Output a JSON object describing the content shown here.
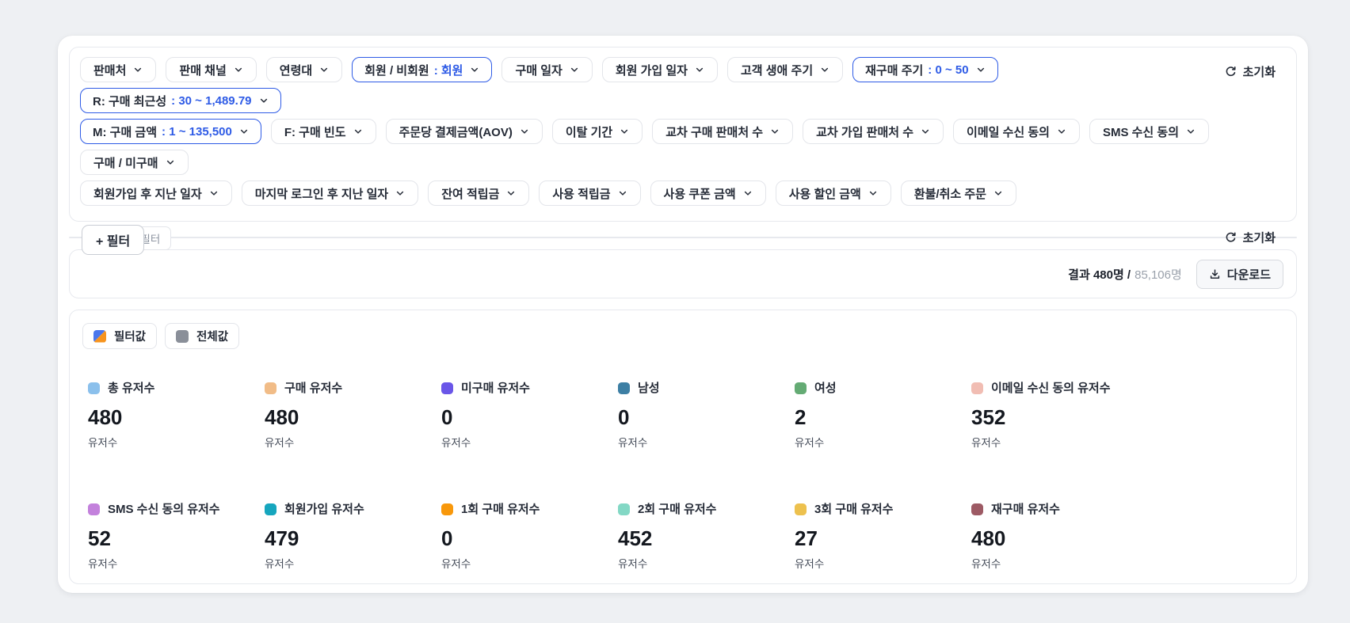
{
  "accent_color": "#2E5BE6",
  "filter_panel": {
    "reset_label": "초기화",
    "rows": [
      [
        {
          "label": "판매처"
        },
        {
          "label": "판매 채널"
        },
        {
          "label": "연령대"
        },
        {
          "label": "회원 / 비회원",
          "value": ": 회원"
        },
        {
          "label": "구매 일자"
        },
        {
          "label": "회원 가입 일자"
        },
        {
          "label": "고객 생애 주기"
        },
        {
          "label": "재구매 주기",
          "value": ": 0 ~ 50"
        },
        {
          "label": "R: 구매 최근성",
          "value": ": 30 ~ 1,489.79"
        }
      ],
      [
        {
          "label": "M: 구매 금액",
          "value": ": 1 ~ 135,500"
        },
        {
          "label": "F: 구매 빈도"
        },
        {
          "label": "주문당 결제금액(AOV)"
        },
        {
          "label": "이탈 기간"
        },
        {
          "label": "교차 구매 판매처 수"
        },
        {
          "label": "교차 가입 판매처 수"
        },
        {
          "label": "이메일 수신 동의"
        },
        {
          "label": "SMS 수신 동의"
        },
        {
          "label": "구매 / 미구매"
        }
      ],
      [
        {
          "label": "회원가입 후 지난 일자"
        },
        {
          "label": "마지막 로그인 후 지난 일자"
        },
        {
          "label": "잔여 적립금"
        },
        {
          "label": "사용 적립금"
        },
        {
          "label": "사용 쿠폰 금액"
        },
        {
          "label": "사용 할인 금액"
        },
        {
          "label": "환불/취소 주문"
        }
      ]
    ]
  },
  "segment_panel": {
    "title": "세그먼트 필터",
    "add_filter_label": "+ 필터",
    "reset_label": "초기화"
  },
  "results_bar": {
    "result_text": "결과 480명 /",
    "total_text": "85,106명",
    "download_label": "다운로드"
  },
  "metrics_panel": {
    "legend": [
      {
        "label": "필터값",
        "color_top": "#4A77ED",
        "color_bottom": "#F7941E"
      },
      {
        "label": "전체값",
        "color": "#8A8F99"
      }
    ],
    "cards": [
      {
        "label": "총 유저수",
        "value": "480",
        "sublabel": "유저수",
        "color": "#8BC0EC"
      },
      {
        "label": "구매 유저수",
        "value": "480",
        "sublabel": "유저수",
        "color": "#F1BC87"
      },
      {
        "label": "미구매 유저수",
        "value": "0",
        "sublabel": "유저수",
        "color": "#6A56E8"
      },
      {
        "label": "남성",
        "value": "0",
        "sublabel": "유저수",
        "color": "#3D7FA4"
      },
      {
        "label": "여성",
        "value": "2",
        "sublabel": "유저수",
        "color": "#64AB74"
      },
      {
        "label": "이메일 수신 동의 유저수",
        "value": "352",
        "sublabel": "유저수",
        "color": "#F1BDB3"
      },
      {
        "label": "SMS 수신 동의 유저수",
        "value": "52",
        "sublabel": "유저수",
        "color": "#C381DC"
      },
      {
        "label": "회원가입 유저수",
        "value": "479",
        "sublabel": "유저수",
        "color": "#16A6BE"
      },
      {
        "label": "1회 구매 유저수",
        "value": "0",
        "sublabel": "유저수",
        "color": "#F8980B"
      },
      {
        "label": "2회 구매 유저수",
        "value": "452",
        "sublabel": "유저수",
        "color": "#83D8C5"
      },
      {
        "label": "3회 구매 유저수",
        "value": "27",
        "sublabel": "유저수",
        "color": "#EDC14E"
      },
      {
        "label": "재구매 유저수",
        "value": "480",
        "sublabel": "유저수",
        "color": "#9D5A64"
      }
    ]
  }
}
